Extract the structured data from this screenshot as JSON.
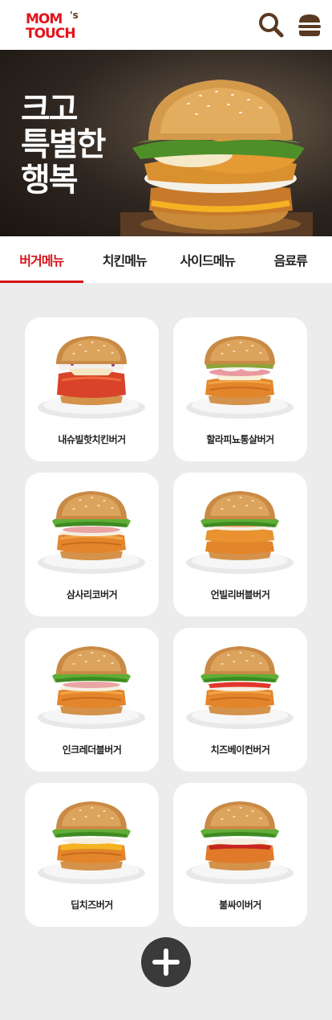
{
  "header": {
    "logo_line1": "MOM",
    "logo_s": "'s",
    "logo_line2": "TOUCH",
    "search_icon": "search-icon",
    "menu_icon": "burger-menu-icon"
  },
  "hero": {
    "line1": "크고",
    "line2": "특별한",
    "line3": "행복"
  },
  "tabs": [
    {
      "label": "버거메뉴",
      "active": true
    },
    {
      "label": "치킨메뉴",
      "active": false
    },
    {
      "label": "사이드메뉴",
      "active": false
    },
    {
      "label": "음료류",
      "active": false
    }
  ],
  "menu_items": [
    {
      "name": "내슈빌핫치킨버거"
    },
    {
      "name": "할라피뇨통살버거"
    },
    {
      "name": "삼사리코버거"
    },
    {
      "name": "언빌리버블버거"
    },
    {
      "name": "인크레더블버거"
    },
    {
      "name": "치즈베이컨버거"
    },
    {
      "name": "딥치즈버거"
    },
    {
      "name": "불싸이버거"
    }
  ],
  "colors": {
    "brand_red": "#d5121a",
    "logo_red": "#e4131b",
    "icon_brown": "#5a3a22",
    "plus_button": "#3a3a3a"
  }
}
